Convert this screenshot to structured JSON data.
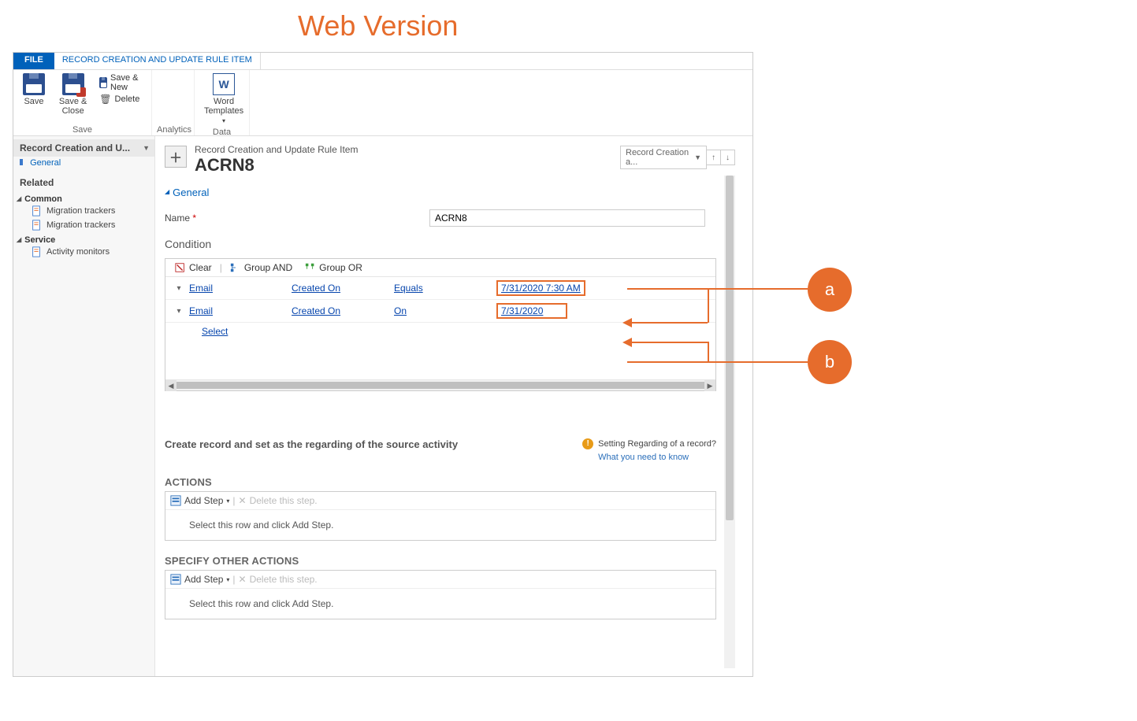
{
  "page_header": "Web Version",
  "tabs": {
    "file": "FILE",
    "context": "RECORD CREATION AND UPDATE RULE ITEM"
  },
  "ribbon": {
    "save_group": {
      "label": "Save",
      "save": "Save",
      "save_close": "Save & Close",
      "save_new": "Save & New",
      "delete": "Delete"
    },
    "analytics_group": {
      "label": "Analytics"
    },
    "data_group": {
      "label": "Data",
      "word_templates": "Word Templates"
    }
  },
  "sidebar": {
    "title": "Record Creation and U...",
    "section_general": "General",
    "related": "Related",
    "group_common": "Common",
    "migration1": "Migration trackers",
    "migration2": "Migration trackers",
    "group_service": "Service",
    "activity_monitors": "Activity monitors"
  },
  "header": {
    "type": "Record Creation and Update Rule Item",
    "name": "ACRN8",
    "selector": "Record Creation a..."
  },
  "general": {
    "section": "General",
    "name_label": "Name",
    "name_value": "ACRN8"
  },
  "condition": {
    "heading": "Condition",
    "clear": "Clear",
    "group_and": "Group AND",
    "group_or": "Group OR",
    "rows": [
      {
        "entity": "Email",
        "field": "Created On",
        "operator": "Equals",
        "value": "7/31/2020 7:30 AM"
      },
      {
        "entity": "Email",
        "field": "Created On",
        "operator": "On",
        "value": "7/31/2020"
      }
    ],
    "select": "Select"
  },
  "create_record": {
    "heading": "Create record and set as the regarding of the source activity",
    "info_title": "Setting Regarding of a record?",
    "info_link": "What you need to know"
  },
  "actions": {
    "heading": "ACTIONS",
    "add_step": "Add Step",
    "delete_step": "Delete this step.",
    "placeholder": "Select this row and click Add Step."
  },
  "specify": {
    "heading": "SPECIFY OTHER ACTIONS",
    "add_step": "Add Step",
    "delete_step": "Delete this step.",
    "placeholder": "Select this row and click Add Step."
  },
  "callouts": {
    "a": "a",
    "b": "b"
  }
}
